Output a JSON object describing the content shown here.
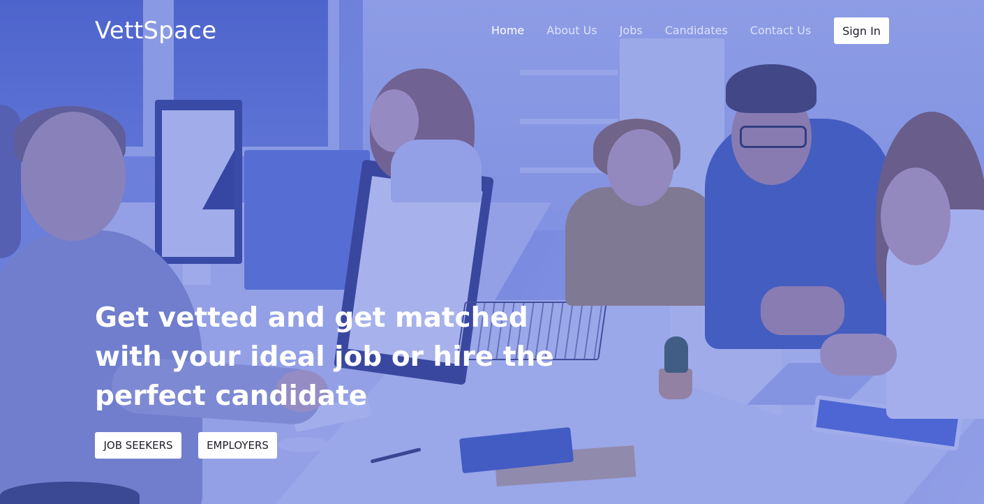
{
  "brand": {
    "name": "VettSpace"
  },
  "nav": {
    "items": [
      {
        "label": "Home",
        "active": true
      },
      {
        "label": "About Us",
        "active": false
      },
      {
        "label": "Jobs",
        "active": false
      },
      {
        "label": "Candidates",
        "active": false
      },
      {
        "label": "Contact Us",
        "active": false
      }
    ],
    "signin_label": "Sign In"
  },
  "hero": {
    "headline": "Get vetted and get matched with your ideal job or hire the perfect candidate",
    "buttons": {
      "job_seekers": "JOB SEEKERS",
      "employers": "EMPLOYERS"
    },
    "background": "office-teamwork-photo"
  },
  "colors": {
    "overlay": "#4c62d6",
    "text": "#ffffff",
    "button_bg": "#ffffff",
    "button_text": "#1c1c2a"
  }
}
